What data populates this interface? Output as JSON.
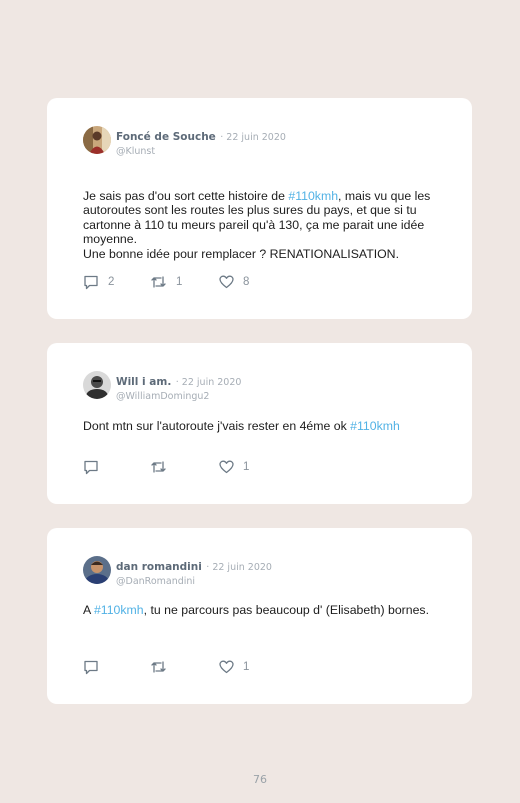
{
  "tweets": [
    {
      "author": "Foncé de Souche",
      "date": "· 22 juin 2020",
      "handle": "@Klunst",
      "text": [
        {
          "t": "Je sais pas d'ou sort cette histoire de ",
          "tag": false
        },
        {
          "t": "#110kmh",
          "tag": true
        },
        {
          "t": ", mais vu que les autoroutes sont les routes les plus sures du pays, et que si tu cartonne à 110 tu meurs pareil qu'à 130, ça me parait une idée moyenne.\nUne bonne idée pour remplacer ? RENATIONALISATION.",
          "tag": false
        }
      ],
      "replies": "2",
      "retweets": "1",
      "likes": "8"
    },
    {
      "author": "Will i am.",
      "date": "· 22 juin 2020",
      "handle": "@WilliamDomingu2",
      "text": [
        {
          "t": "Dont mtn sur l'autoroute j'vais rester en 4éme ok ",
          "tag": false
        },
        {
          "t": "#110kmh",
          "tag": true
        }
      ],
      "replies": "",
      "retweets": "",
      "likes": "1"
    },
    {
      "author": "dan romandini",
      "date": "· 22 juin 2020",
      "handle": "@DanRomandini",
      "text": [
        {
          "t": "A ",
          "tag": false
        },
        {
          "t": "#110kmh",
          "tag": true
        },
        {
          "t": ", tu ne parcours pas beaucoup d' (Elisabeth) bornes.",
          "tag": false
        }
      ],
      "replies": "",
      "retweets": "",
      "likes": "1"
    }
  ],
  "colors": {
    "hashtag": "#52b2e5",
    "background": "#efe7e3",
    "card": "#ffffff"
  },
  "icons": {
    "reply": "speech-bubble-icon",
    "retweet": "retweet-icon",
    "like": "heart-icon"
  },
  "page_number": "76"
}
